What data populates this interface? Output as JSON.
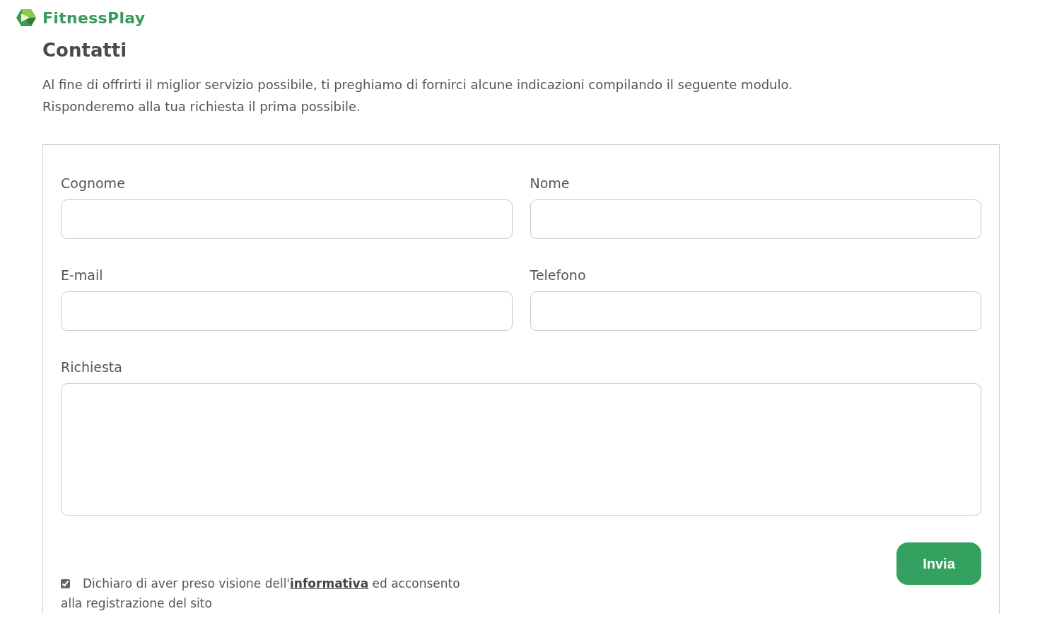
{
  "brand": {
    "name": "FitnessPlay"
  },
  "title": "Contatti",
  "intro": [
    "Al fine di offrirti il miglior servizio possibile, ti preghiamo di fornirci alcune indicazioni compilando il seguente modulo.",
    "Risponderemo alla tua richiesta il prima possibile."
  ],
  "form": {
    "fields": [
      {
        "label": "Cognome",
        "kind": "input"
      },
      {
        "label": "Nome",
        "kind": "input"
      },
      {
        "label": "E-mail",
        "kind": "input"
      },
      {
        "label": "Telefono",
        "kind": "input"
      },
      {
        "label": "Richiesta",
        "kind": "textarea"
      }
    ],
    "consent": {
      "checked": true,
      "before": "Dichiaro di aver preso visione dell'",
      "link": "informativa",
      "after": " ed acconsento alla registrazione del sito"
    },
    "submit": "Invia"
  }
}
